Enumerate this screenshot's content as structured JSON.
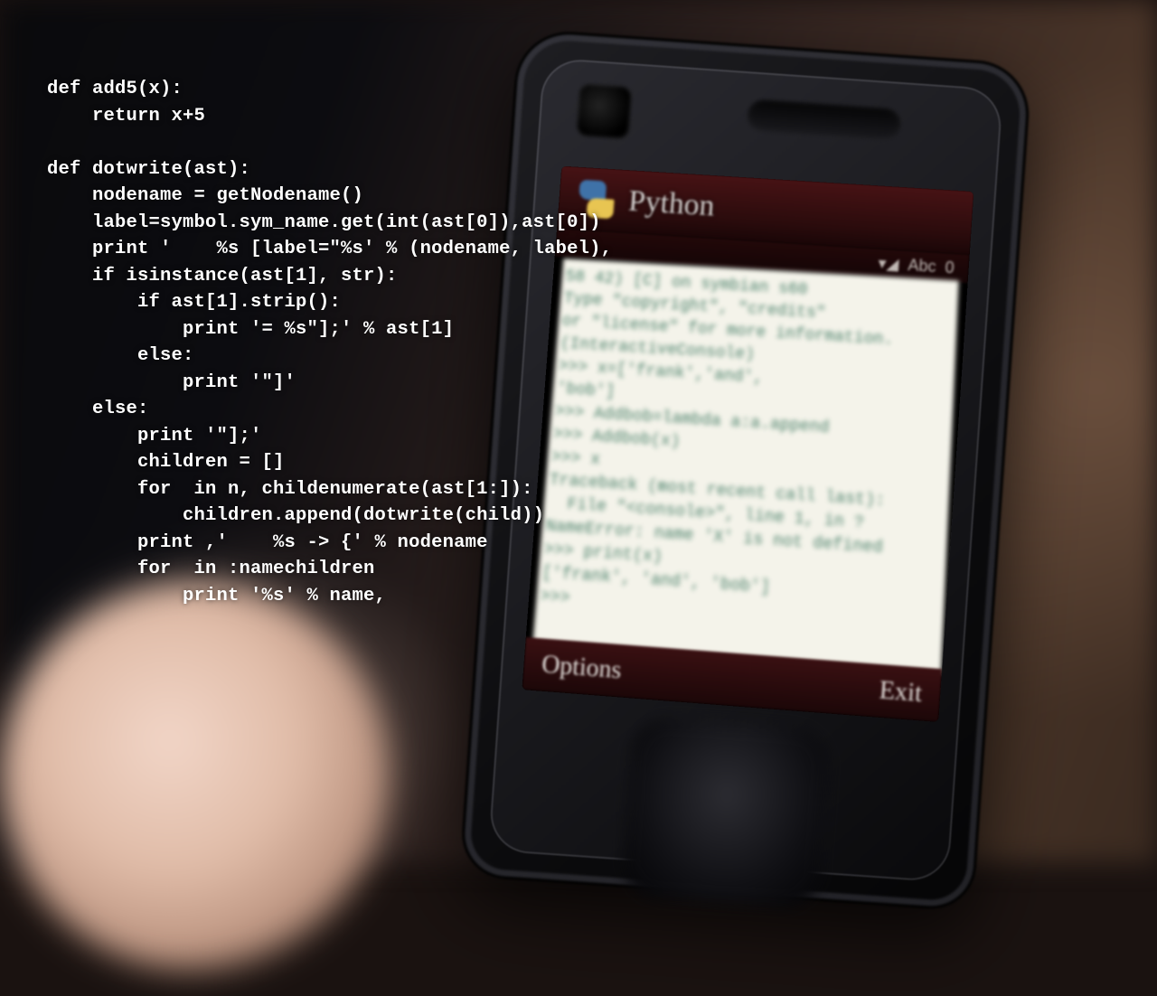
{
  "code_overlay": "def add5(x):\n    return x+5\n\ndef dotwrite(ast):\n    nodename = getNodename()\n    label=symbol.sym_name.get(int(ast[0]),ast[0])\n    print '    %s [label=\"%s' % (nodename, label),\n    if isinstance(ast[1], str):\n        if ast[1].strip():\n            print '= %s\"];' % ast[1]\n        else:\n            print '\"]'\n    else:\n        print '\"];'\n        children = []\n        for  in n, childenumerate(ast[1:]):\n            children.append(dotwrite(child))\n        print ,'    %s -> {' % nodename\n        for  in :namechildren\n            print '%s' % name,",
  "phone": {
    "title": "Python",
    "status": {
      "mode": "Abc",
      "count": "0"
    },
    "softkeys": {
      "left": "Options",
      "right": "Exit"
    },
    "console": "58 42) [C] on symbian s60\nType \"copyright\", \"credits\"\nor \"license\" for more information.\n(InteractiveConsole)\n>>> x=['frank','and',\n'bob']\n>>> Addbob=lambda a:a.append\n>>> Addbob(x)\n>>> x\nTraceback (most recent call last):\n  File \"<console>\", line 1, in ?\nNameError: name 'X' is not defined\n>>> print(x)\n['frank', 'and', 'bob']\n>>> "
  }
}
